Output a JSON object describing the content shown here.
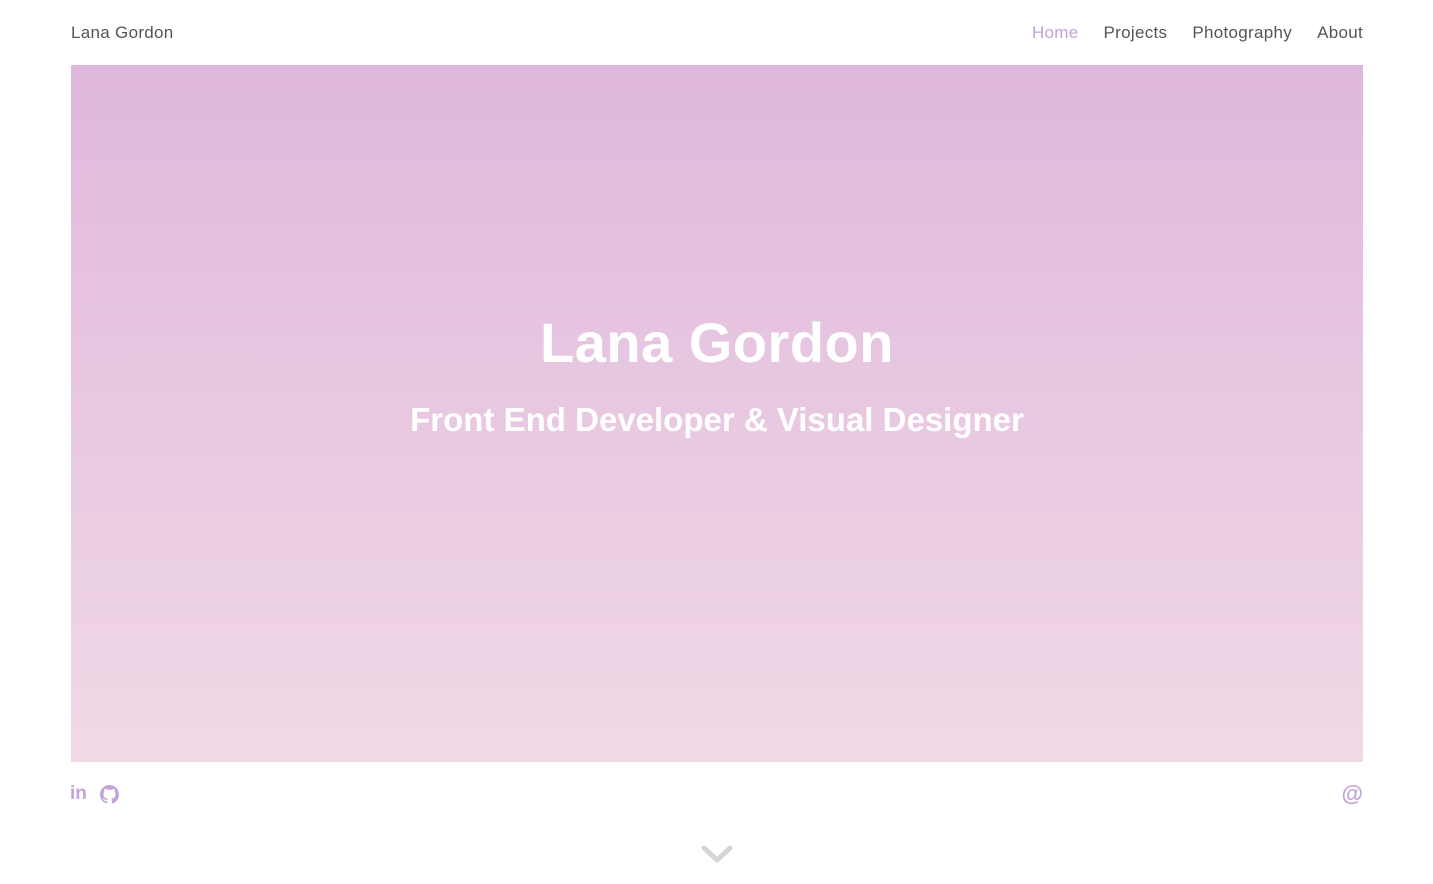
{
  "header": {
    "brand": "Lana Gordon",
    "nav": [
      {
        "label": "Home",
        "active": true
      },
      {
        "label": "Projects",
        "active": false
      },
      {
        "label": "Photography",
        "active": false
      },
      {
        "label": "About",
        "active": false
      }
    ]
  },
  "hero": {
    "title": "Lana Gordon",
    "subtitle": "Front End Developer & Visual Designer",
    "gradient_top": "#dfb8dd",
    "gradient_bottom": "#f1d9e5"
  },
  "social": {
    "linkedin_glyph": "in",
    "linkedin_icon": "linkedin-icon",
    "github_icon": "github-icon",
    "email_glyph": "@",
    "email_icon": "email-at-icon"
  },
  "scroll": {
    "icon": "chevron-down-icon"
  },
  "colors": {
    "accent": "#c3a3d8",
    "nav_text": "#555555",
    "hero_text": "#ffffff",
    "chevron": "#d6d6d6"
  }
}
